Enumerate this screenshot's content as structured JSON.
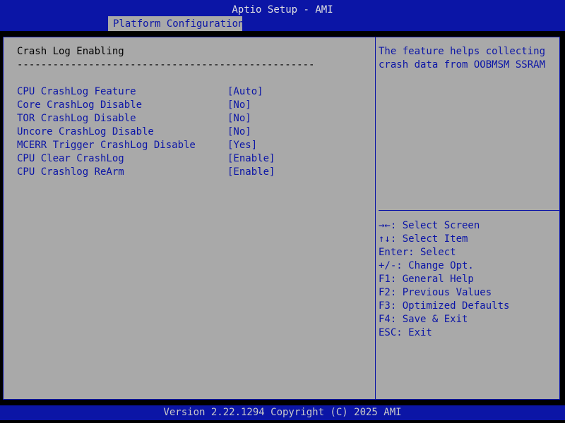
{
  "header": {
    "title": "Aptio Setup - AMI",
    "tab_label": "Platform Configuration"
  },
  "section": {
    "title": "Crash Log Enabling",
    "separator": "--------------------------------------------------"
  },
  "options": [
    {
      "label": "CPU CrashLog Feature",
      "value": "[Auto]"
    },
    {
      "label": "Core CrashLog Disable",
      "value": "[No]"
    },
    {
      "label": "TOR CrashLog Disable",
      "value": "[No]"
    },
    {
      "label": "Uncore CrashLog Disable",
      "value": "[No]"
    },
    {
      "label": "MCERR Trigger CrashLog Disable",
      "value": "[Yes]"
    },
    {
      "label": "CPU Clear CrashLog",
      "value": "[Enable]"
    },
    {
      "label": "CPU Crashlog ReArm",
      "value": "[Enable]"
    }
  ],
  "help": {
    "lines": [
      "The feature helps collecting",
      "crash data from OOBMSM SSRAM"
    ]
  },
  "keys": [
    "→←: Select Screen",
    "↑↓: Select Item",
    "Enter: Select",
    "+/-: Change Opt.",
    "F1: General Help",
    "F2: Previous Values",
    "F3: Optimized Defaults",
    "F4: Save & Exit",
    "ESC: Exit"
  ],
  "footer": {
    "text": "Version 2.22.1294 Copyright (C) 2025 AMI"
  },
  "colors": {
    "header_bg": "#0b15a6",
    "panel_bg": "#a9a9a9",
    "text_blue": "#0b15a6"
  }
}
